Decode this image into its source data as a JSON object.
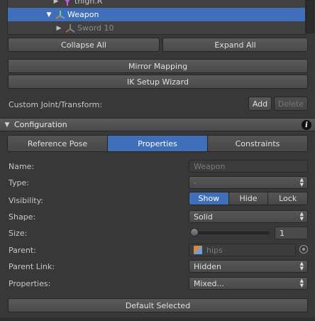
{
  "tree": {
    "rows": [
      {
        "label": "thigh.R",
        "state": "collapsed",
        "selected": false
      },
      {
        "label": "Weapon",
        "state": "expanded",
        "selected": true
      },
      {
        "label": "Sword 10",
        "state": "collapsed",
        "selected": false
      }
    ]
  },
  "actions": {
    "collapse_all": "Collapse All",
    "expand_all": "Expand All",
    "mirror_mapping": "Mirror Mapping",
    "ik_setup_wizard": "IK Setup Wizard",
    "custom_joint_label": "Custom Joint/Transform:",
    "add": "Add",
    "delete": "Delete"
  },
  "configuration": {
    "header": "Configuration",
    "info_icon": "info-icon",
    "tabs": [
      {
        "label": "Reference Pose",
        "active": false
      },
      {
        "label": "Properties",
        "active": true
      },
      {
        "label": "Constraints",
        "active": false
      }
    ],
    "fields": {
      "name_label": "Name:",
      "name_value": "Weapon",
      "type_label": "Type:",
      "type_value": "-",
      "visibility_label": "Visibility:",
      "visibility_options": [
        "Show",
        "Hide",
        "Lock"
      ],
      "visibility_selected": "Show",
      "shape_label": "Shape:",
      "shape_value": "Solid",
      "size_label": "Size:",
      "size_value": "1",
      "size_slider_fraction": 0.0,
      "parent_label": "Parent:",
      "parent_value": "hips",
      "parent_link_label": "Parent Link:",
      "parent_link_value": "Hidden",
      "properties_label": "Properties:",
      "properties_value": "Mixed..."
    },
    "default_selected": "Default Selected"
  },
  "colors": {
    "selection": "#3e6fb8",
    "background": "#383838"
  }
}
